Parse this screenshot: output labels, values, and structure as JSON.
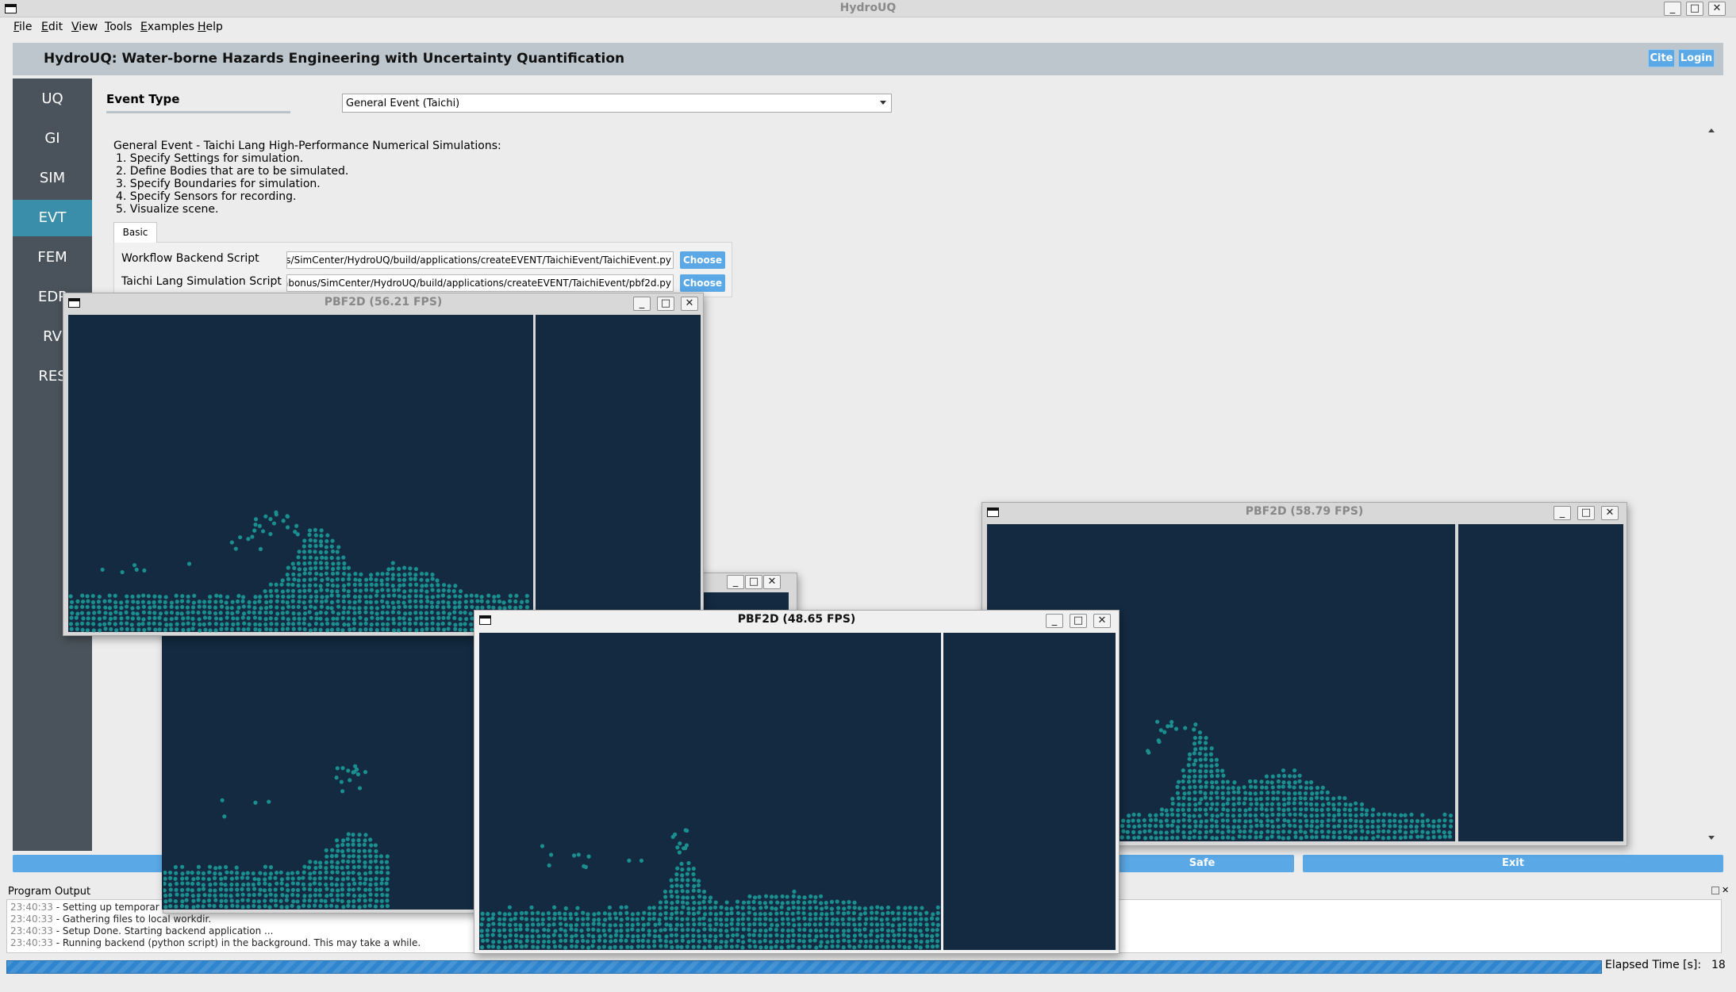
{
  "window": {
    "title": "HydroUQ"
  },
  "menu": [
    {
      "pre": "",
      "u": "F",
      "rest": "ile"
    },
    {
      "pre": "",
      "u": "E",
      "rest": "dit"
    },
    {
      "pre": "",
      "u": "V",
      "rest": "iew"
    },
    {
      "pre": "",
      "u": "T",
      "rest": "ools"
    },
    {
      "pre": "",
      "u": "E",
      "rest": "xamples"
    },
    {
      "pre": "",
      "u": "H",
      "rest": "elp"
    }
  ],
  "header": {
    "title": "HydroUQ: Water-borne Hazards Engineering with Uncertainty Quantification",
    "cite_label": "Cite",
    "login_label": "Login"
  },
  "sidebar": {
    "items": [
      {
        "label": "UQ"
      },
      {
        "label": "GI"
      },
      {
        "label": "SIM"
      },
      {
        "label": "EVT"
      },
      {
        "label": "FEM"
      },
      {
        "label": "EDP"
      },
      {
        "label": "RV"
      },
      {
        "label": "RES"
      }
    ]
  },
  "event": {
    "type_label": "Event Type",
    "type_value": "General Event (Taichi)",
    "description": [
      "General Event - Taichi Lang High-Performance Numerical Simulations:",
      "1. Specify Settings for simulation.",
      "2. Define Bodies that are to be simulated.",
      "3. Specify Boundaries for simulation.",
      "4. Specify Sensors for recording.",
      "5. Visualize scene."
    ],
    "tab_label": "Basic",
    "backend_label": "Workflow Backend Script",
    "backend_value": "s/SimCenter/HydroUQ/build/applications/createEVENT/TaichiEvent/TaichiEvent.py",
    "sim_label": "Taichi Lang Simulation Script",
    "sim_value": "abonus/SimCenter/HydroUQ/build/applications/createEVENT/TaichiEvent/pbf2d.py",
    "choose_label": "Choose"
  },
  "bottom": {
    "run_label": "",
    "safe_label": "Safe",
    "exit_label": "Exit"
  },
  "output": {
    "label": "Program Output",
    "lines": [
      {
        "time": "23:40:33",
        "text": " - Setting up temporar"
      },
      {
        "time": "23:40:33",
        "text": " - Gathering files to local workdir."
      },
      {
        "time": "23:40:33",
        "text": " - Setup Done. Starting backend application ..."
      },
      {
        "time": "23:40:33",
        "text": " - Running backend (python script) in the background. This may take a while."
      }
    ]
  },
  "status": {
    "progress": 1.0,
    "elapsed_label": "Elapsed Time [s]:",
    "elapsed_value": "18"
  },
  "popups": {
    "p1": {
      "title": "PBF2D (56.21 FPS)"
    },
    "p2": {
      "title": "PBF2D (58.79 FPS)"
    },
    "p3": {
      "title": "PBF2D (48.65 FPS)"
    }
  },
  "colors": {
    "particle": "#1b8f8f",
    "canvas_bg": "#132a40",
    "accent": "#5aa8e6",
    "active_side": "#3a8ea9"
  }
}
